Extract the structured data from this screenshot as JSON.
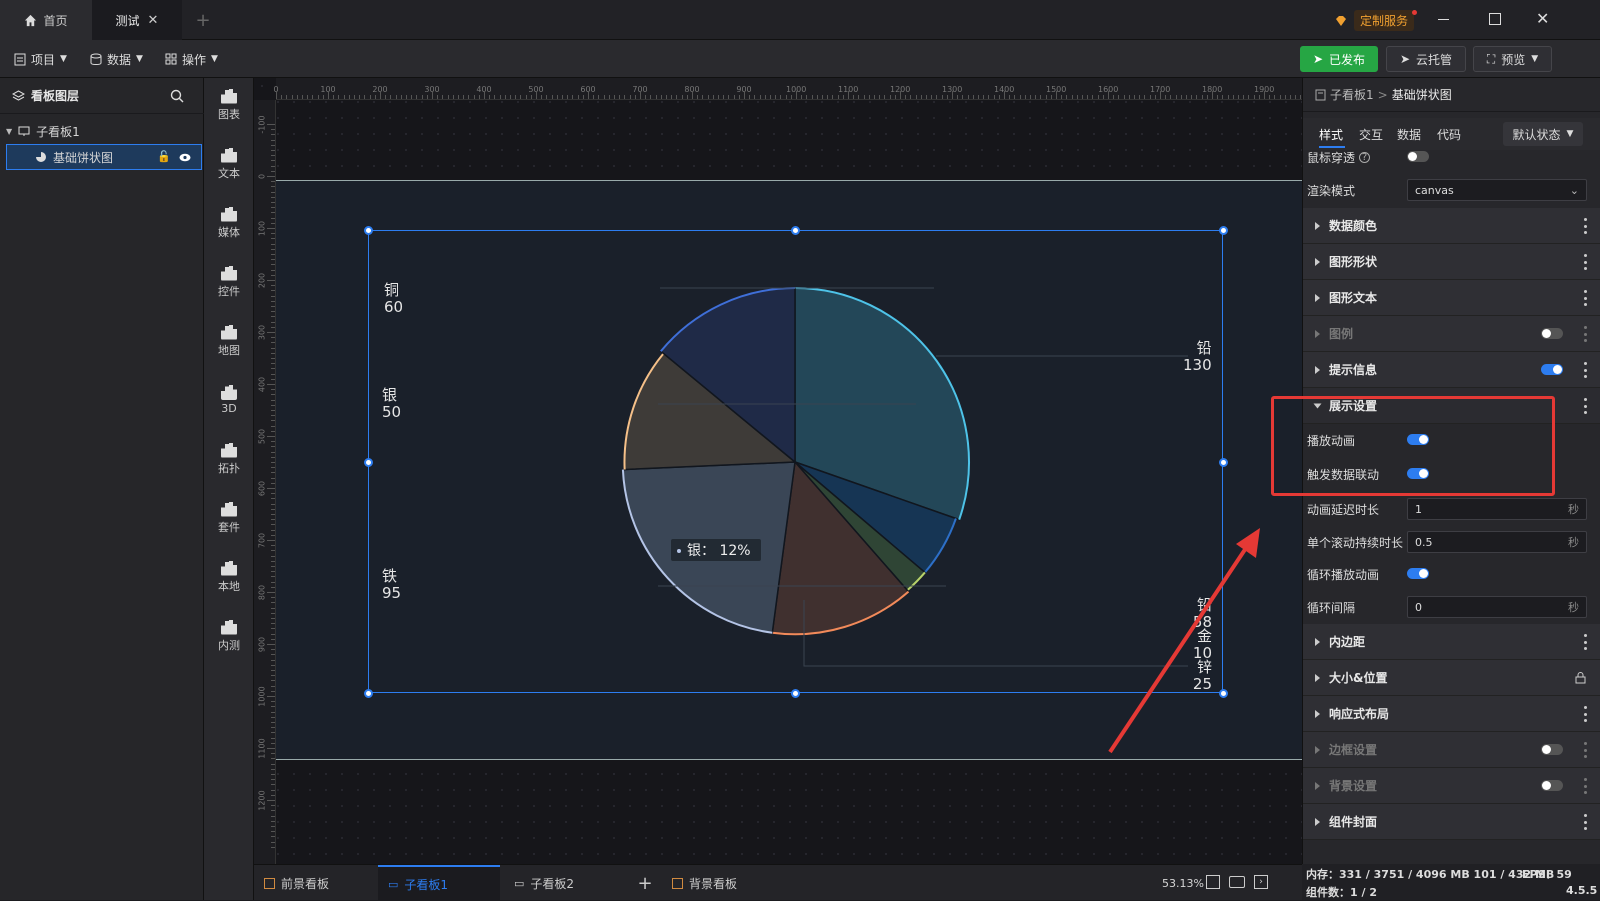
{
  "titlebar": {
    "home_tab": "首页",
    "active_tab": "测试",
    "service_label": "定制服务"
  },
  "toolbar": {
    "project": "项目",
    "data": "数据",
    "operate": "操作",
    "published": "已发布",
    "cloud_host": "云托管",
    "preview": "预览"
  },
  "layers": {
    "title": "看板图层",
    "tree": [
      {
        "label": "子看板1"
      },
      {
        "label": "基础饼状图"
      }
    ]
  },
  "rail": {
    "items": [
      {
        "label": "图表",
        "icon": "bar-chart-icon"
      },
      {
        "label": "文本",
        "icon": "text-icon"
      },
      {
        "label": "媒体",
        "icon": "media-icon"
      },
      {
        "label": "控件",
        "icon": "control-icon"
      },
      {
        "label": "地图",
        "icon": "map-icon"
      },
      {
        "label": "3D",
        "icon": "cube-icon"
      },
      {
        "label": "拓扑",
        "icon": "topology-icon"
      },
      {
        "label": "套件",
        "icon": "kit-icon"
      },
      {
        "label": "本地",
        "icon": "puzzle-icon"
      },
      {
        "label": "内测",
        "icon": "beta-chart-icon"
      }
    ]
  },
  "ruler": {
    "top_ticks": [
      "0",
      "100",
      "200",
      "300",
      "400",
      "500",
      "600",
      "700",
      "800",
      "900",
      "1000",
      "1100",
      "1200",
      "1300",
      "1400",
      "1500",
      "1600",
      "1700",
      "1800",
      "1900"
    ],
    "left_ticks": [
      "-100",
      "0",
      "100",
      "200",
      "300",
      "400",
      "500",
      "600",
      "700",
      "800",
      "900",
      "1000",
      "1100",
      "1200"
    ]
  },
  "chart_data": {
    "type": "pie",
    "categories": [
      "铅",
      "锌",
      "金",
      "铅",
      "铁",
      "银",
      "铜"
    ],
    "values": [
      130,
      25,
      10,
      58,
      95,
      50,
      60
    ],
    "slice_colors": [
      "#4ec3e8",
      "#2d6fc7",
      "#b8d36a",
      "#f28a5a",
      "#b4c4e6",
      "#f5c089",
      "#3f6fd8"
    ],
    "tooltip": "银：  12%"
  },
  "pie_labels": [
    {
      "name": "铜",
      "value": "60"
    },
    {
      "name": "银",
      "value": "50"
    },
    {
      "name": "铁",
      "value": "95"
    },
    {
      "name": "铅",
      "value": "130"
    },
    {
      "name": "铅",
      "value": "58"
    },
    {
      "name": "金",
      "value": "10"
    },
    {
      "name": "锌",
      "value": "25"
    }
  ],
  "right": {
    "breadcrumb_parent": "子看板1",
    "breadcrumb_sep": ">",
    "breadcrumb_current": "基础饼状图",
    "tabs": [
      "样式",
      "交互",
      "数据",
      "代码"
    ],
    "state_select": "默认状态",
    "mouse_through": "鼠标穿透",
    "render_mode_label": "渲染模式",
    "render_mode_value": "canvas",
    "sections_top": [
      "数据颜色",
      "图形形状",
      "图形文本",
      "图例",
      "提示信息"
    ],
    "display_settings": "展示设置",
    "play_animation": "播放动画",
    "trigger_linkage": "触发数据联动",
    "anim_delay_label": "动画延迟时长",
    "anim_delay_value": "1",
    "scroll_duration_label": "单个滚动持续时长",
    "scroll_duration_value": "0.5",
    "loop_anim_label": "循环播放动画",
    "loop_interval_label": "循环间隔",
    "loop_interval_value": "0",
    "unit_sec": "秒",
    "sections_bottom": [
      "内边距",
      "大小&位置",
      "响应式布局",
      "边框设置",
      "背景设置",
      "组件封面"
    ]
  },
  "bottom": {
    "tabs": [
      "前景看板",
      "子看板1",
      "子看板2",
      "背景看板"
    ],
    "zoom": "53.13%"
  },
  "status": {
    "memory_label": "内存：",
    "memory_value": "331 / 3751 / 4096 MB  101 / 432 MB",
    "fps_label": "FPS：",
    "fps_value": "59",
    "components_label": "组件数：",
    "components_value": "1 / 2",
    "version": "4.5.5"
  },
  "colors": {
    "accent": "#2d7df0",
    "publish_green": "#26a644",
    "highlight_red": "#e53935",
    "service_orange": "#f0a030"
  }
}
